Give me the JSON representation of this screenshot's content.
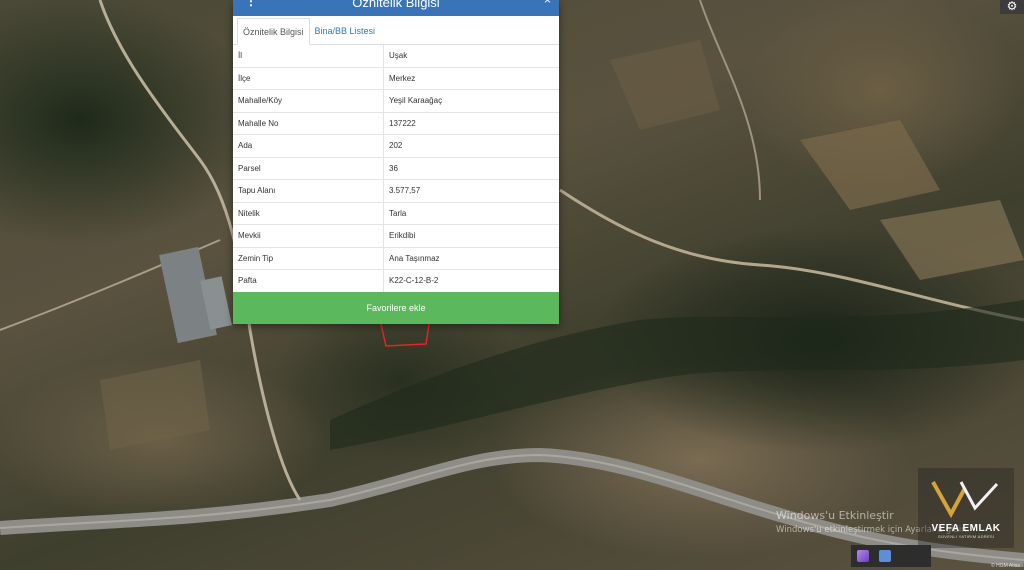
{
  "panel": {
    "title": "Öznitelik Bilgisi",
    "menu_icon": "vertical-ellipsis-icon",
    "close_label": "×",
    "tabs": [
      {
        "label": "Öznitelik Bilgisi",
        "active": true
      },
      {
        "label": "Bina/BB Listesi",
        "active": false
      }
    ],
    "rows": [
      {
        "key": "İl",
        "value": "Uşak"
      },
      {
        "key": "İlçe",
        "value": "Merkez"
      },
      {
        "key": "Mahalle/Köy",
        "value": "Yeşil Karaağaç"
      },
      {
        "key": "Mahalle No",
        "value": "137222"
      },
      {
        "key": "Ada",
        "value": "202"
      },
      {
        "key": "Parsel",
        "value": "36"
      },
      {
        "key": "Tapu Alanı",
        "value": "3.577,57"
      },
      {
        "key": "Nitelik",
        "value": "Tarla"
      },
      {
        "key": "Mevkii",
        "value": "Erikdibi"
      },
      {
        "key": "Zemin Tip",
        "value": "Ana Taşınmaz"
      },
      {
        "key": "Pafta",
        "value": "K22-C-12-B-2"
      }
    ],
    "favorite_button": "Favorilere ekle"
  },
  "settings_icon": "gear-icon",
  "watermark": {
    "line1": "Windows'u Etkinleştir",
    "line2": "Windows'u etkinleştirmek için Ayarlar'a gidin."
  },
  "brand": {
    "name": "VEFA EMLAK",
    "tagline": "GÜVENLİ YATIRIM ADRESİ"
  },
  "attribution": "© HGM Atlas",
  "colors": {
    "header": "#3a74b8",
    "button": "#5cb85c",
    "parcel_outline": "#e0262a"
  }
}
